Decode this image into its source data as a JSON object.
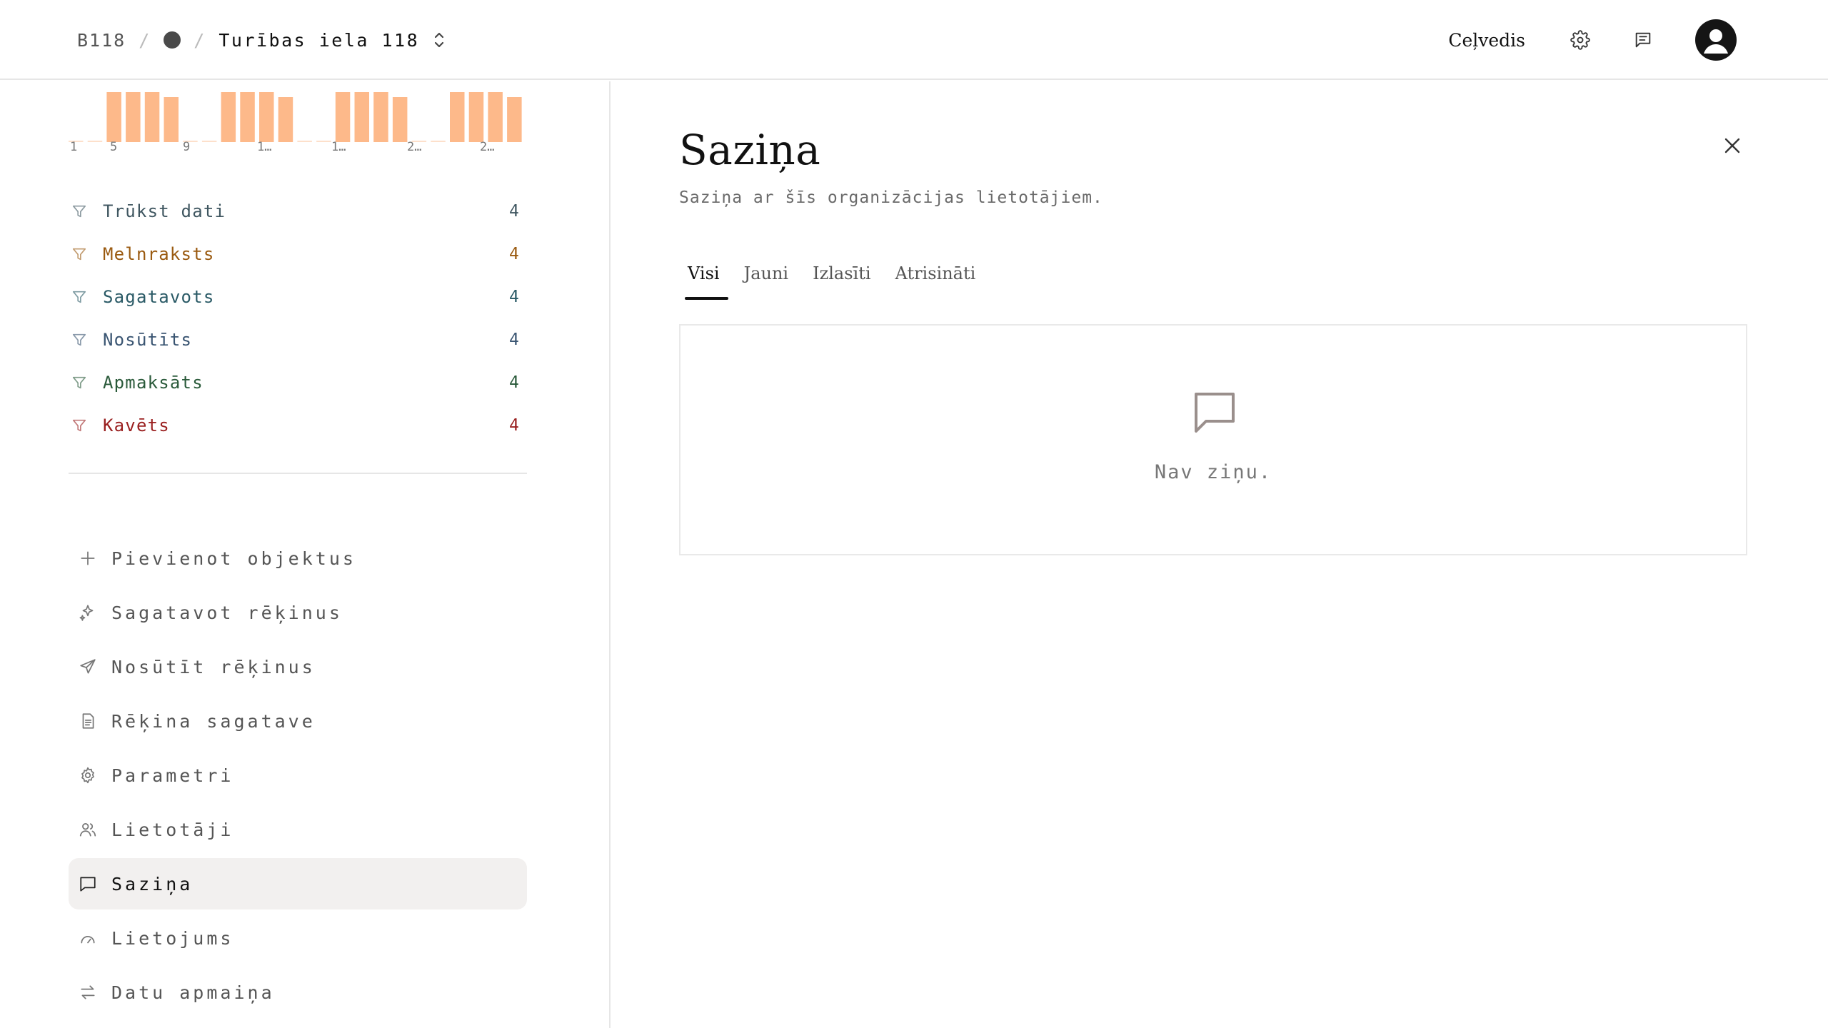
{
  "breadcrumb": {
    "code": "B118",
    "separator": "/",
    "address": "Turības iela 118"
  },
  "header": {
    "guide_label": "Ceļvedis"
  },
  "chart_data": {
    "type": "bar",
    "tick_labels": [
      "1",
      "5",
      "9",
      "1…",
      "1…",
      "2…",
      "2…"
    ],
    "values": [
      0,
      0,
      1,
      1,
      1,
      0.9,
      0,
      0,
      1,
      1,
      1,
      0.9,
      0,
      0,
      1,
      1,
      1,
      0.9,
      0,
      0,
      1,
      1,
      1,
      0.9
    ],
    "color": "#fdb98a"
  },
  "filters": [
    {
      "label": "Trūkst dati",
      "count": "4",
      "color": "#3f5660"
    },
    {
      "label": "Melnraksts",
      "count": "4",
      "color": "#9a5a10"
    },
    {
      "label": "Sagatavots",
      "count": "4",
      "color": "#2a5a66"
    },
    {
      "label": "Nosūtīts",
      "count": "4",
      "color": "#3a5572"
    },
    {
      "label": "Apmaksāts",
      "count": "4",
      "color": "#2a5a3a"
    },
    {
      "label": "Kavēts",
      "count": "4",
      "color": "#9a2020"
    }
  ],
  "nav": [
    {
      "label": "Pievienot objektus",
      "icon": "plus-icon"
    },
    {
      "label": "Sagatavot rēķinus",
      "icon": "sparkles-icon"
    },
    {
      "label": "Nosūtīt rēķinus",
      "icon": "send-icon"
    },
    {
      "label": "Rēķina sagatave",
      "icon": "document-icon"
    },
    {
      "label": "Parametri",
      "icon": "gear-icon"
    },
    {
      "label": "Lietotāji",
      "icon": "users-icon"
    },
    {
      "label": "Saziņa",
      "icon": "chat-icon",
      "active": true
    },
    {
      "label": "Lietojums",
      "icon": "gauge-icon"
    },
    {
      "label": "Datu apmaiņa",
      "icon": "arrows-exchange-icon"
    }
  ],
  "panel": {
    "title": "Saziņa",
    "subtitle": "Saziņa ar šīs organizācijas lietotājiem.",
    "tabs": [
      "Visi",
      "Jauni",
      "Izlasīti",
      "Atrisināti"
    ],
    "active_tab": "Visi",
    "empty_text": "Nav ziņu."
  }
}
